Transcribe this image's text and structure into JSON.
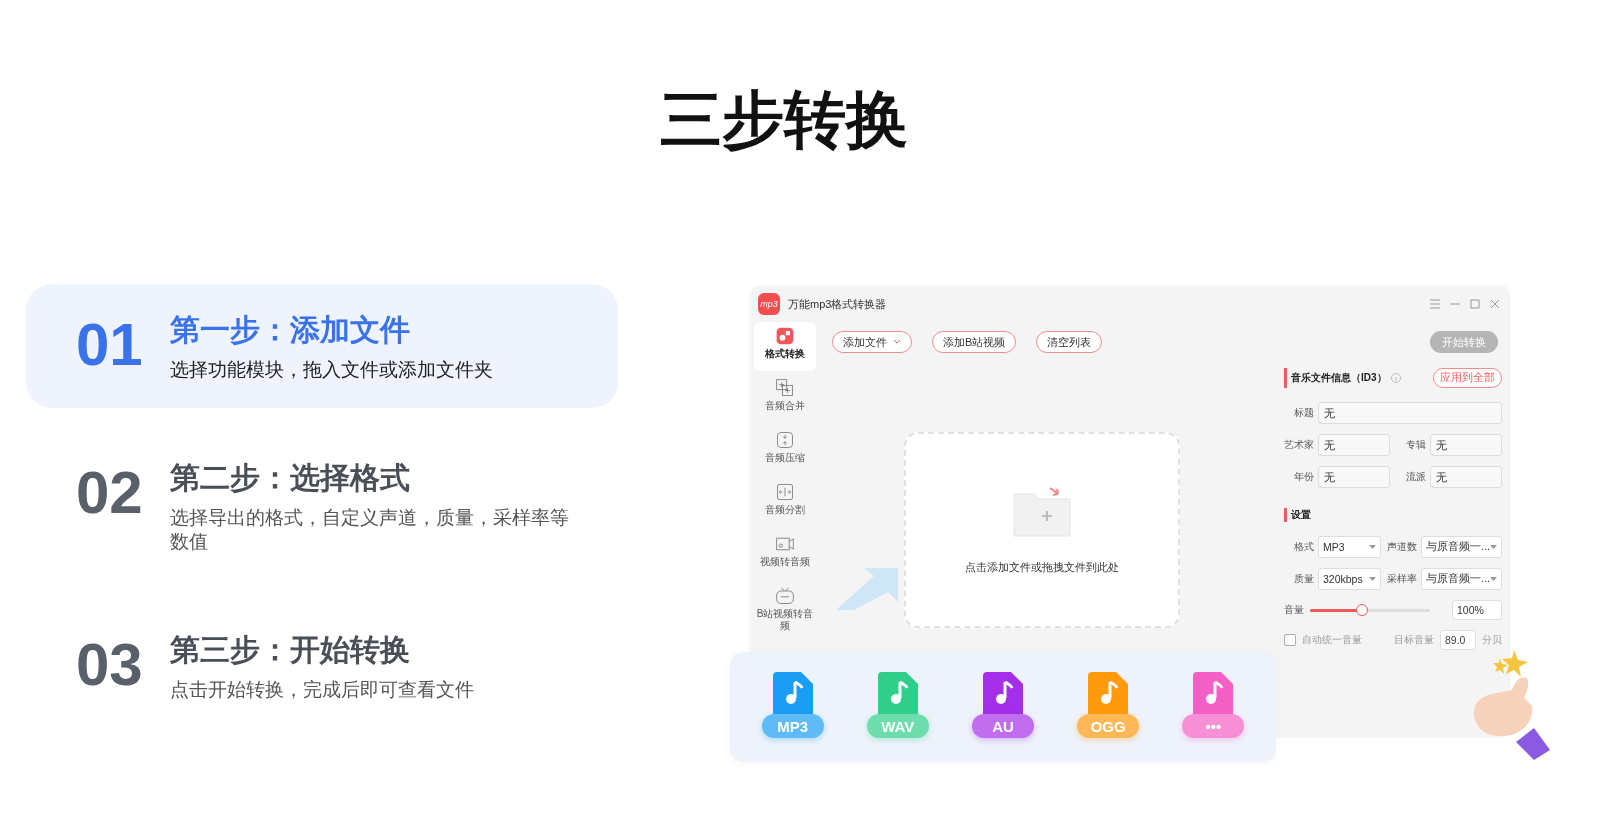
{
  "page_title": "三步转换",
  "steps": [
    {
      "number": "01",
      "title": "第一步：添加文件",
      "description": "选择功能模块，拖入文件或添加文件夹",
      "selected": true
    },
    {
      "number": "02",
      "title": "第二步：选择格式",
      "description": "选择导出的格式，自定义声道，质量，采样率等数值",
      "selected": false
    },
    {
      "number": "03",
      "title": "第三步：开始转换",
      "description": "点击开始转换，完成后即可查看文件",
      "selected": false
    }
  ],
  "app": {
    "title": "万能mp3格式转换器",
    "logo": "mp3",
    "sidebar": [
      {
        "label": "格式转换",
        "kind": "convert",
        "selected": true
      },
      {
        "label": "音频合并",
        "kind": "merge",
        "selected": false
      },
      {
        "label": "音频压缩",
        "kind": "compress",
        "selected": false
      },
      {
        "label": "音频分割",
        "kind": "split",
        "selected": false
      },
      {
        "label": "视频转音频",
        "kind": "video",
        "selected": false
      },
      {
        "label": "B站视频转音频",
        "kind": "tv",
        "selected": false
      }
    ],
    "toolbar": [
      {
        "label": "添加文件",
        "dropdown": true
      },
      {
        "label": "添加B站视频",
        "dropdown": false
      },
      {
        "label": "清空列表",
        "dropdown": false
      }
    ],
    "start_button": {
      "label": "开始转换",
      "disabled": true
    },
    "drop_hint": "点击添加文件或拖拽文件到此处",
    "id3": {
      "heading": "音乐文件信息（ID3）",
      "apply_all": "应用到全部",
      "rows": [
        [
          {
            "label": "标题",
            "value": "无"
          }
        ],
        [
          {
            "label": "艺术家",
            "value": "无"
          },
          {
            "label": "专辑",
            "value": "无"
          }
        ],
        [
          {
            "label": "年份",
            "value": "无"
          },
          {
            "label": "流派",
            "value": "无"
          }
        ]
      ]
    },
    "settings": {
      "heading": "设置",
      "selects": [
        {
          "label": "格式",
          "value": "MP3"
        },
        {
          "label": "声道数",
          "value": "与原音频一..."
        },
        {
          "label": "质量",
          "value": "320kbps"
        },
        {
          "label": "采样率",
          "value": "与原音频一..."
        }
      ],
      "volume": {
        "label": "音量",
        "level": 0.43,
        "value": "100%"
      },
      "auto_volume": {
        "label": "自动统一音量",
        "checked": false
      },
      "target": {
        "label": "目标音量",
        "value": "89.0",
        "unit": "分贝"
      }
    }
  },
  "formats": [
    {
      "label": "MP3",
      "color": "#1a9df2"
    },
    {
      "label": "WAV",
      "color": "#2fcf8a"
    },
    {
      "label": "AU",
      "color": "#a52ee8"
    },
    {
      "label": "OGG",
      "color": "#ff9a0e"
    },
    {
      "label": "•••",
      "color": "#f45fc6"
    }
  ]
}
